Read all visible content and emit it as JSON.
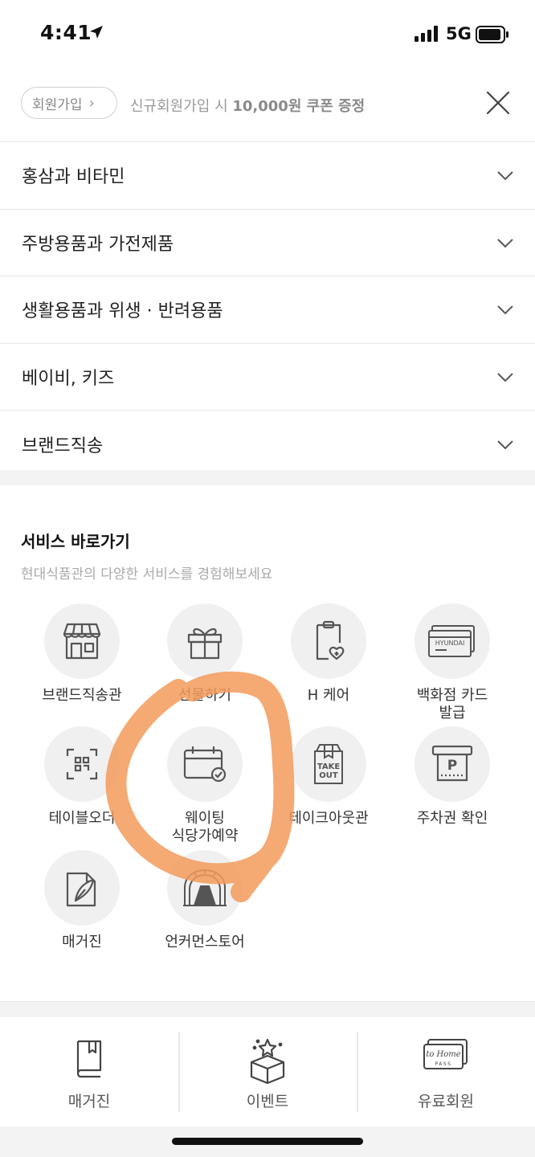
{
  "status_bar": {
    "time": "4:41",
    "network": "5G"
  },
  "signup": {
    "button_label": "회원가입",
    "promo_prefix": "신규회원가입 시 ",
    "promo_highlight": "10,000원 쿠폰 증정"
  },
  "categories": [
    {
      "label": "홍삼과 비타민"
    },
    {
      "label": "주방용품과 가전제품"
    },
    {
      "label": "생활용품과 위생 · 반려용품"
    },
    {
      "label": "베이비, 키즈"
    },
    {
      "label": "브랜드직송"
    }
  ],
  "services": {
    "title": "서비스 바로가기",
    "subtitle": "현대식품관의 다양한 서비스를 경험해보세요",
    "items": [
      {
        "label": "브랜드직송관",
        "icon": "storefront-icon"
      },
      {
        "label": "선물하기",
        "icon": "gift-icon"
      },
      {
        "label": "H 케어",
        "icon": "clipboard-heart-icon"
      },
      {
        "label": "백화점 카드\n발급",
        "icon": "card-icon"
      },
      {
        "label": "테이블오더",
        "icon": "qr-scan-icon"
      },
      {
        "label": "웨이팅\n식당가예약",
        "icon": "calendar-check-icon"
      },
      {
        "label": "테이크아웃관",
        "icon": "takeout-bag-icon"
      },
      {
        "label": "주차권 확인",
        "icon": "parking-ticket-icon"
      },
      {
        "label": "매거진",
        "icon": "feather-page-icon"
      },
      {
        "label": "언커먼스토어",
        "icon": "dome-store-icon"
      }
    ]
  },
  "bottom_links": [
    {
      "label": "매거진",
      "icon": "book-icon"
    },
    {
      "label": "이벤트",
      "icon": "gift-box-star-icon"
    },
    {
      "label": "유료회원",
      "icon": "to-home-pass-icon"
    }
  ],
  "icon_card_text": "HYUNDAI",
  "icon_takeout_text": [
    "TAKE",
    "OUT"
  ],
  "icon_parking_text": "P",
  "icon_pass_text": [
    "to Home",
    "PASS"
  ],
  "colors": {
    "highlight": "#f39a5b",
    "divider": "#e6e6e6",
    "circle_bg": "#f0f0f0"
  }
}
